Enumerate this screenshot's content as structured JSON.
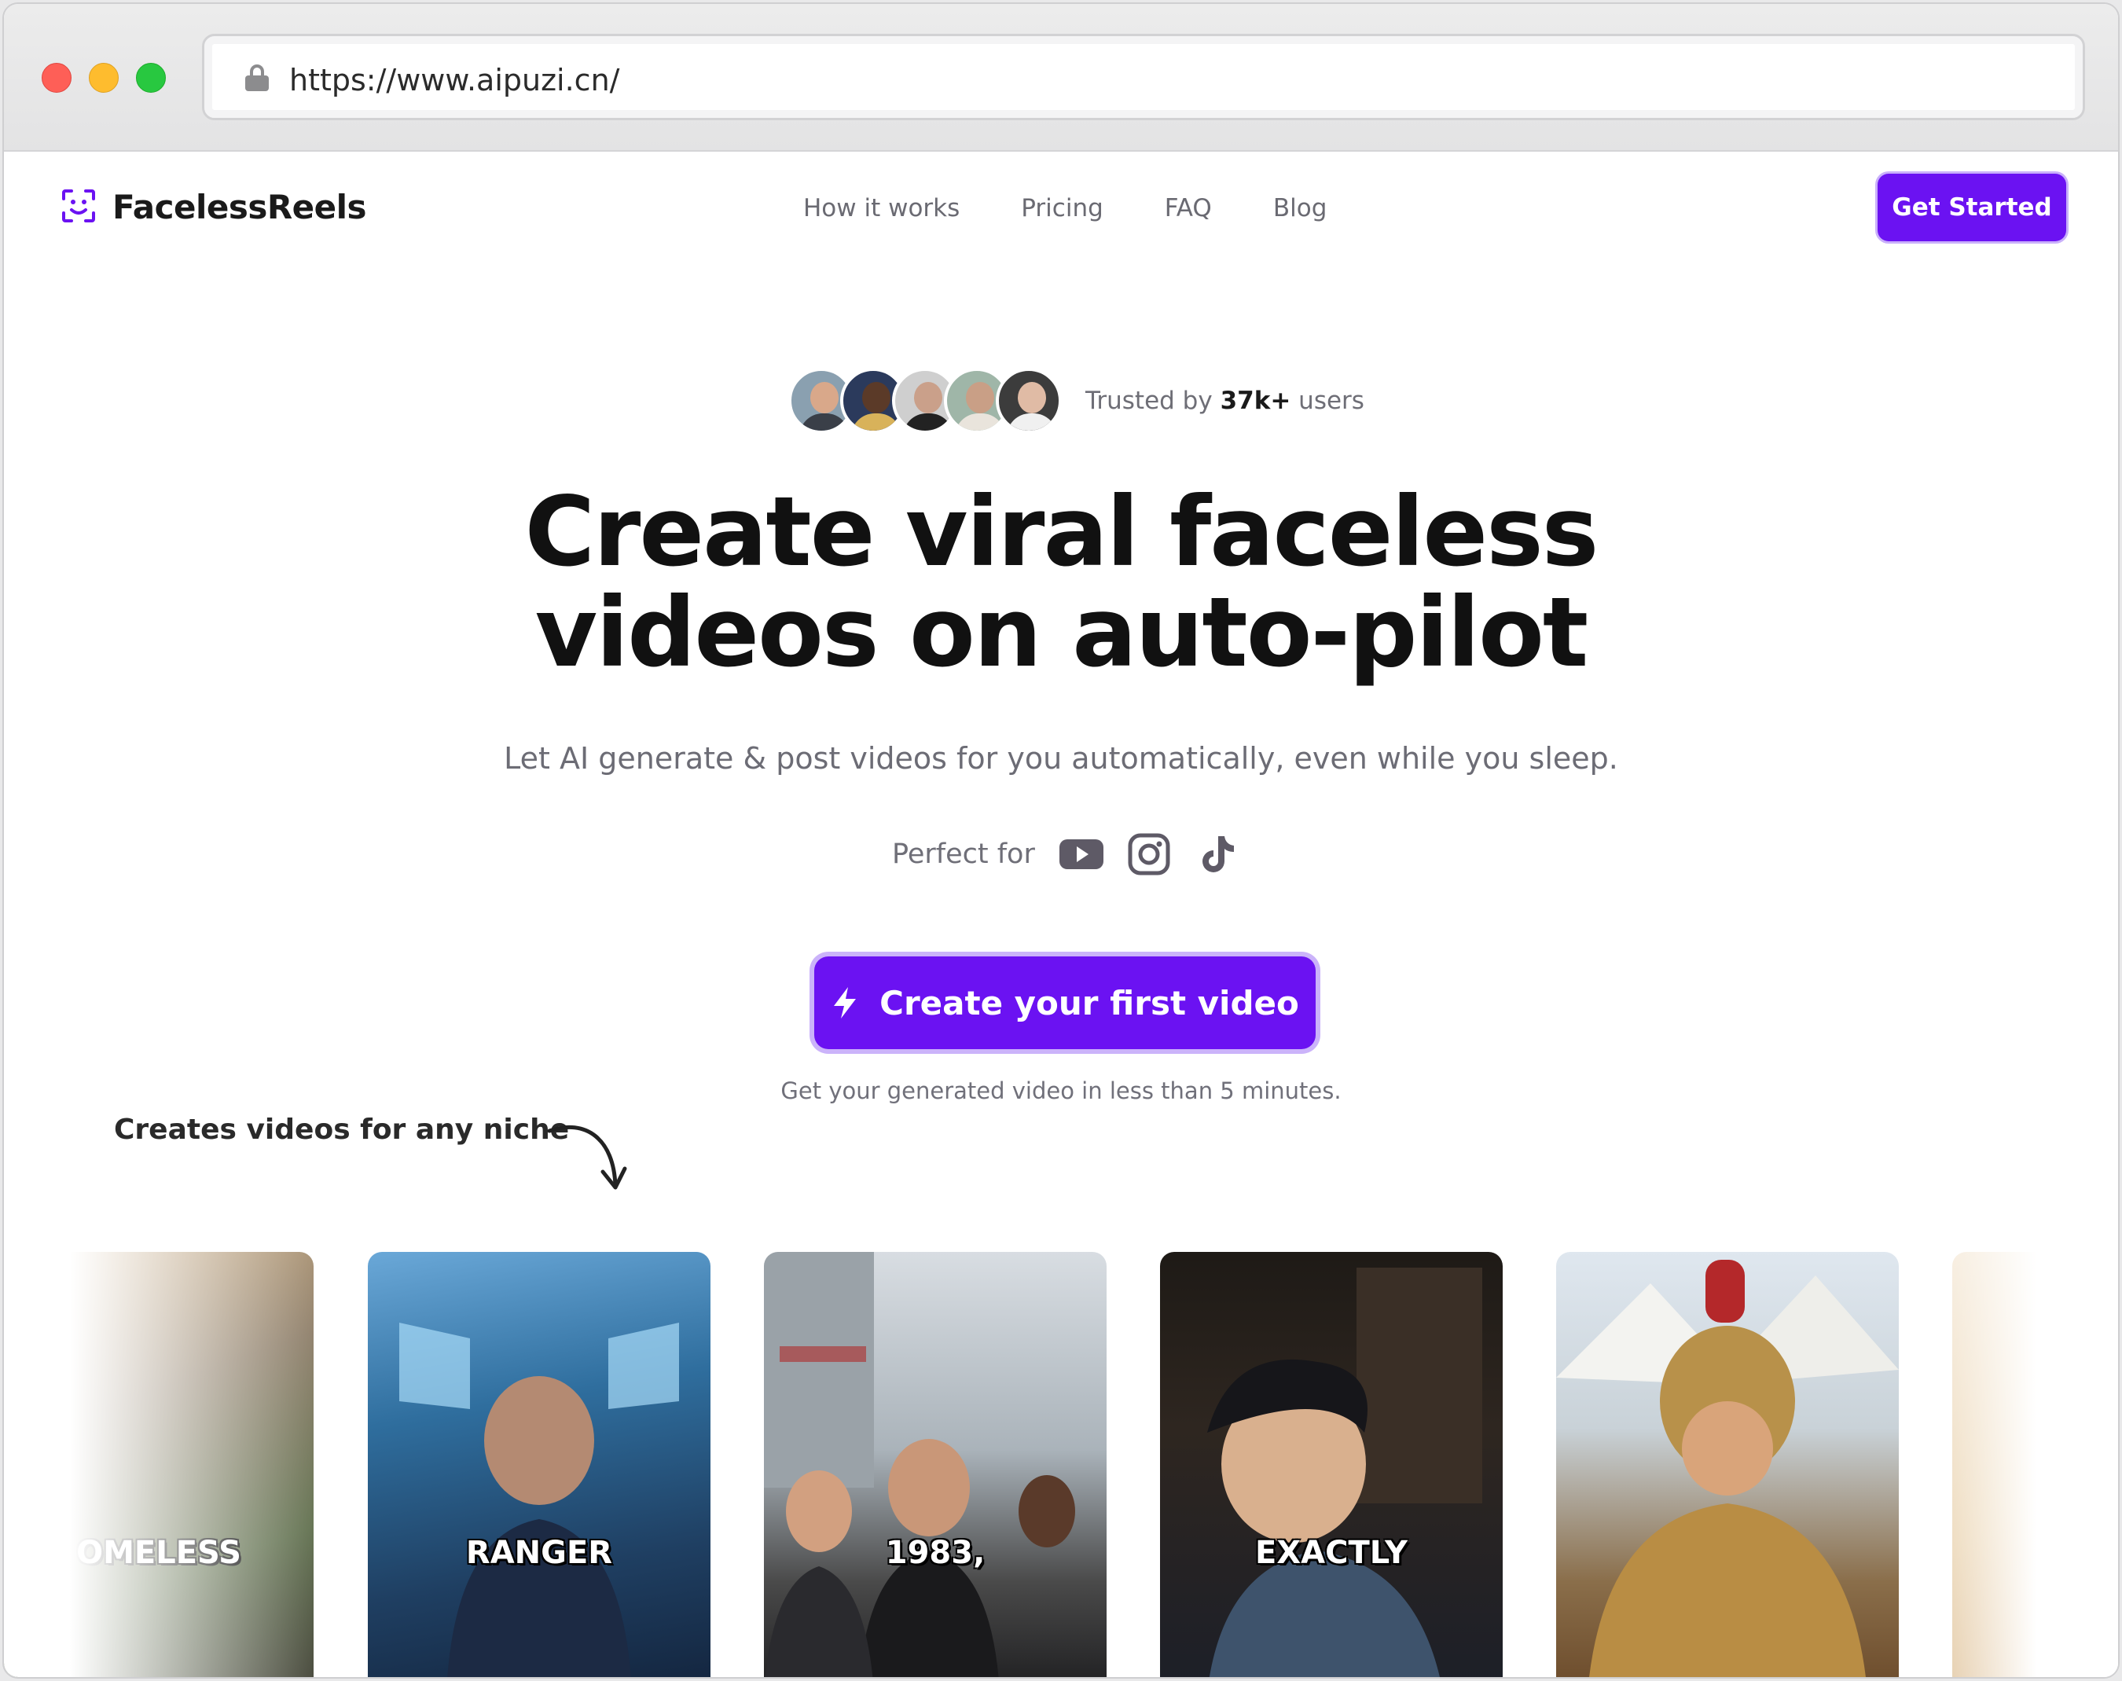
{
  "browser": {
    "url": "https://www.aipuzi.cn/"
  },
  "nav": {
    "logo_text": "FacelessReels",
    "links": [
      "How it works",
      "Pricing",
      "FAQ",
      "Blog"
    ],
    "cta_label": "Get Started"
  },
  "hero": {
    "trusted_prefix": "Trusted by",
    "trusted_count": "37k+",
    "trusted_suffix": "users",
    "title_line1": "Create viral faceless",
    "title_line2": "videos on auto-pilot",
    "subtitle": "Let AI generate & post videos for you automatically, even while you sleep.",
    "perfect_for_label": "Perfect for",
    "platforms": [
      "youtube-icon",
      "instagram-icon",
      "tiktok-icon"
    ],
    "cta_label": "Create your first video",
    "cta_note": "Get your generated video in less than 5 minutes."
  },
  "niche": {
    "label": "Creates videos for any niche"
  },
  "gallery": {
    "cards": [
      {
        "caption": "OMELESS"
      },
      {
        "caption": "RANGER"
      },
      {
        "caption": "1983,"
      },
      {
        "caption": "EXACTLY"
      },
      {
        "caption": ""
      },
      {
        "caption": ""
      }
    ]
  },
  "colors": {
    "accent": "#6b12f2",
    "accent_ring": "#cbb3fa"
  }
}
